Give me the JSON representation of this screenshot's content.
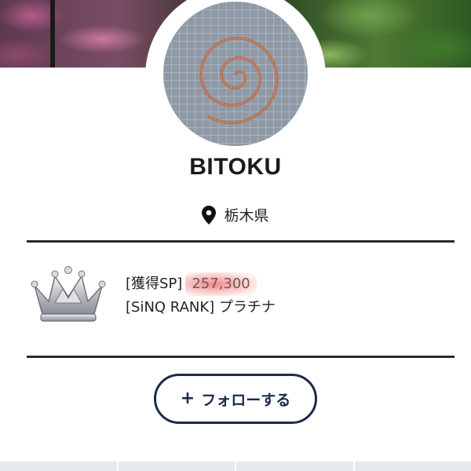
{
  "profile": {
    "name": "BITOKU",
    "location": "栃木県"
  },
  "stats": {
    "sp_label": "[獲得SP]",
    "sp_value": "257,300",
    "rank_label": "[SiNQ RANK]",
    "rank_value": "プラチナ"
  },
  "actions": {
    "follow_plus": "+",
    "follow_label": "フォローする"
  },
  "icons": {
    "location": "map-pin-icon",
    "rank": "platinum-crown-icon"
  },
  "colors": {
    "accent": "#1c2a4a",
    "highlight": "#f25f5f",
    "divider": "#2a2a2a"
  }
}
